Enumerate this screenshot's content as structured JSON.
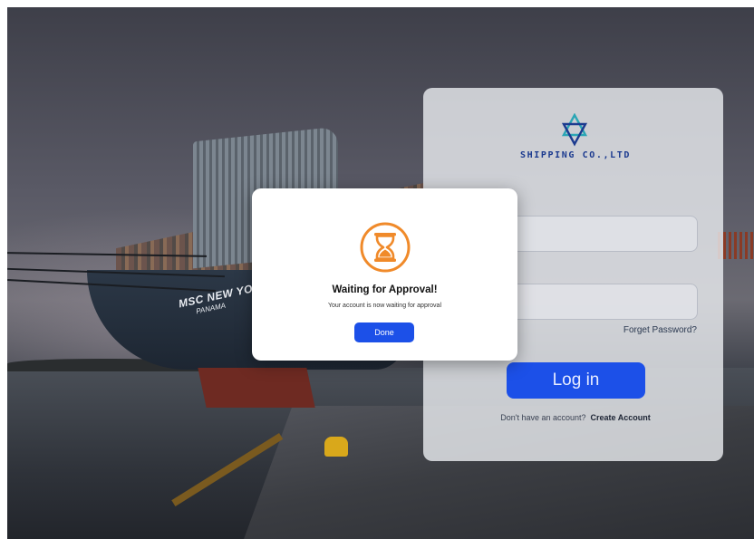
{
  "background": {
    "ship_name": "MSC NEW YORK",
    "ship_port": "PANAMA"
  },
  "login": {
    "logo_icon": "triangle-star-logo",
    "brand": "SHIPPING CO.,LTD",
    "username_value": "",
    "password_value": "",
    "forgot_password": "Forget Password?",
    "login_button": "Log in",
    "no_account_text": "Don't have an account?",
    "create_account": "Create Account"
  },
  "modal": {
    "icon": "hourglass-icon",
    "title": "Waiting for Approval!",
    "message": "Your account is now waiting for approval",
    "done_button": "Done"
  },
  "colors": {
    "primary": "#1c50e8",
    "accent_orange": "#f08a2a",
    "brand_navy": "#1b3a8f",
    "logo_teal": "#2aa6b5"
  }
}
